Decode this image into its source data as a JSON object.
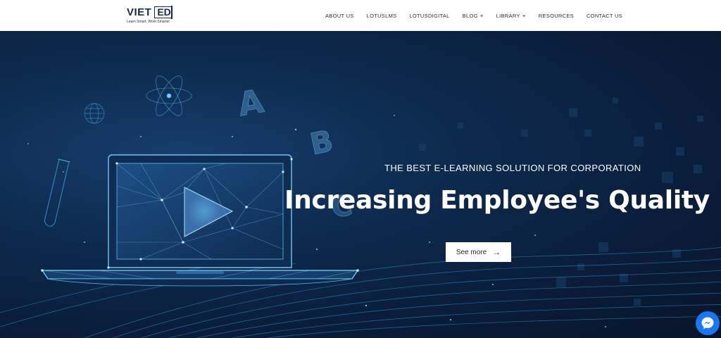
{
  "brand": {
    "name_part1": "VIET",
    "name_part2": "ED",
    "tagline": "Learn Smart, Work Smarter"
  },
  "nav": {
    "items": [
      {
        "label": "ABOUT US",
        "has_submenu": false
      },
      {
        "label": "LOTUSLMS",
        "has_submenu": false
      },
      {
        "label": "LOTUSDIGITAL",
        "has_submenu": false
      },
      {
        "label": "BLOG",
        "has_submenu": true
      },
      {
        "label": "LIBRARY",
        "has_submenu": true
      },
      {
        "label": "RESOURCES",
        "has_submenu": false
      },
      {
        "label": "CONTACT US",
        "has_submenu": false
      }
    ],
    "submenu_marker": "+"
  },
  "hero": {
    "eyebrow": "THE BEST E-LEARNING SOLUTION FOR CORPORATION",
    "headline": "Increasing Employee's Quality",
    "cta_label": "See more",
    "cta_icon": "arrow-right-icon",
    "decor_letters": [
      "A",
      "B",
      "C"
    ]
  },
  "widgets": {
    "chat_icon": "messenger-icon"
  },
  "colors": {
    "header_bg": "#ffffff",
    "hero_bg": "#0d2a4f",
    "accent_glow": "#5ec8ff",
    "messenger": "#1877f2"
  }
}
